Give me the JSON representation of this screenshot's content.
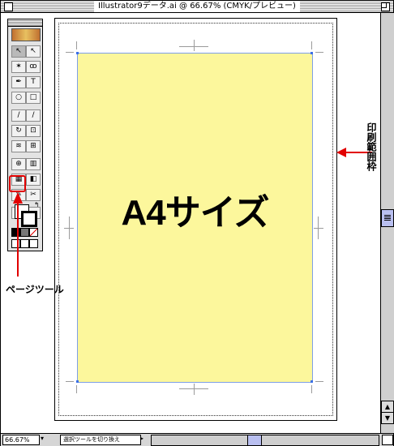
{
  "window": {
    "title": "Illustrator9データ.ai @ 66.67% (CMYK/プレビュー)"
  },
  "artboard": {
    "main_text": "A4サイズ",
    "page_color": "#fcf79c",
    "anchor_color": "#3b6fe6"
  },
  "toolbox": {
    "tools": [
      {
        "name": "selection-tool-icon",
        "glyph": "↖"
      },
      {
        "name": "direct-selection-tool-icon",
        "glyph": "↖"
      },
      {
        "name": "magic-wand-tool-icon",
        "glyph": "✶"
      },
      {
        "name": "lasso-tool-icon",
        "glyph": "ꝏ"
      },
      {
        "name": "pen-tool-icon",
        "glyph": "✒"
      },
      {
        "name": "type-tool-icon",
        "glyph": "T"
      },
      {
        "name": "ellipse-tool-icon",
        "glyph": "○"
      },
      {
        "name": "rectangle-tool-icon",
        "glyph": "□"
      },
      {
        "name": "paintbrush-tool-icon",
        "glyph": "∕"
      },
      {
        "name": "pencil-tool-icon",
        "glyph": "∕"
      },
      {
        "name": "rotate-tool-icon",
        "glyph": "↻"
      },
      {
        "name": "scale-tool-icon",
        "glyph": "⊡"
      },
      {
        "name": "warp-tool-icon",
        "glyph": "≋"
      },
      {
        "name": "free-transform-tool-icon",
        "glyph": "⊞"
      },
      {
        "name": "symbol-tool-icon",
        "glyph": "⊕"
      },
      {
        "name": "graph-tool-icon",
        "glyph": "▥"
      },
      {
        "name": "mesh-tool-icon",
        "glyph": "▦"
      },
      {
        "name": "gradient-tool-icon",
        "glyph": "◧"
      },
      {
        "name": "eyedropper-tool-icon",
        "glyph": "✎"
      },
      {
        "name": "scissors-tool-icon",
        "glyph": "✂"
      },
      {
        "name": "page-tool-icon",
        "glyph": "⬚"
      },
      {
        "name": "zoom-tool-icon",
        "glyph": "⌕"
      }
    ]
  },
  "annotations": {
    "page_tool_label": "ページツール",
    "print_area_label": "印刷範囲枠",
    "accent_color": "#e10000"
  },
  "statusbar": {
    "zoom": "66.67%",
    "status_text": "選択ツールを切り換え"
  }
}
